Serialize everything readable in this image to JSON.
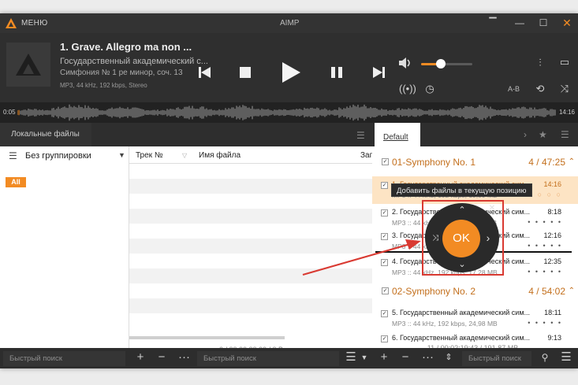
{
  "titlebar": {
    "menu_label": "МЕНЮ",
    "app_title": "AIMP"
  },
  "player": {
    "title": "1. Grave. Allegro ma non ...",
    "artist": "Государственный академический с...",
    "album": "Симфония № 1 ре минор, соч. 13",
    "info": "MP3, 44 kHz, 192 kbps, Stereo",
    "volume_fraction": 0.37,
    "ab_label": "A-B"
  },
  "waveform": {
    "elapsed": "0:05",
    "total": "14:16"
  },
  "local_files": {
    "tab_label": "Локальные файлы",
    "grouping_label": "Без группировки",
    "all_badge": "All",
    "columns": [
      "Трек №",
      "Имя файла",
      "Загр"
    ],
    "status": "0 / 00:00:00:00 / 0 В"
  },
  "playlist": {
    "tab_label": "Default",
    "groups": [
      {
        "name": "01-Symphony No. 1",
        "summary": "4 / 47:25"
      },
      {
        "name": "02-Symphony No. 2",
        "summary": "4 / 54:02"
      }
    ],
    "items": [
      {
        "title": "1. Государственный академический сим...",
        "duration": "14:16",
        "meta": "MP3 :: 44 kHz, 192 kbps, 19,59 MB",
        "dots": "○ ○ ○ ○ ○"
      },
      {
        "title": "2. Государственный академический сим...",
        "duration": "8:18",
        "meta": "MP3 :: 44 kHz, 192 kbps, 11,40 MB",
        "dots": "• • • • •"
      },
      {
        "title": "3. Государственный академический сим...",
        "duration": "12:16",
        "meta": "MP3 :: 44 kHz, 192 kbps, 16,84 MB",
        "dots": "• • • • •"
      },
      {
        "title": "4. Государственный академический сим...",
        "duration": "12:35",
        "meta": "MP3 :: 44 kHz, 192 kbps, 17,28 MB",
        "dots": "• • • • •"
      },
      {
        "title": "5. Государственный академический сим...",
        "duration": "18:11",
        "meta": "MP3 :: 44 kHz, 192 kbps, 24,98 MB",
        "dots": "• • • • •"
      },
      {
        "title": "6. Государственный академический сим...",
        "duration": "9:13",
        "meta": "MP3 :: 44 kHz, 192 kbps, 12,66 MB",
        "dots": "• • • • •"
      }
    ],
    "status": "11 / 00:02:19:43 / 191,87 MB"
  },
  "tooltip": "Добавить файлы в текущую позицию",
  "quick_panel": {
    "ok_label": "OK"
  },
  "bottombar": {
    "search_left": "Быстрый поиск",
    "search_middle": "Быстрый поиск",
    "search_right": "Быстрый поиск"
  },
  "colors": {
    "accent": "#f28b23",
    "annotation": "#d93a32",
    "current_row": "#fde4c4"
  }
}
